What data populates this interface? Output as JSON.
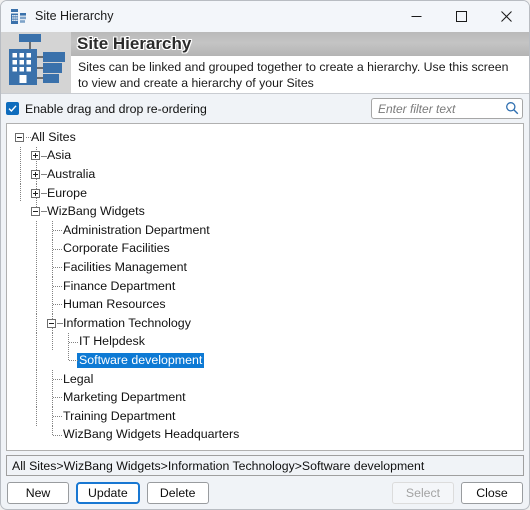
{
  "window": {
    "title": "Site Hierarchy",
    "icon": "site-hierarchy-icon",
    "controls": {
      "minimize": "minimize-icon",
      "maximize": "maximize-icon",
      "close": "close-icon"
    }
  },
  "header": {
    "icon": "building-hierarchy-icon",
    "title": "Site Hierarchy",
    "description": "Sites can be linked and grouped together to create a hierarchy.  Use this screen to view and create a hierarchy of your Sites"
  },
  "options": {
    "dragdrop_label": "Enable drag and drop re-ordering",
    "dragdrop_checked": true,
    "filter_value": "",
    "filter_placeholder": "Enter filter text",
    "filter_icon": "search-icon"
  },
  "tree": {
    "nodes": [
      {
        "label": "All Sites",
        "depth": 0,
        "expander": "minus",
        "selected": false
      },
      {
        "label": "Asia",
        "depth": 1,
        "expander": "plus",
        "selected": false
      },
      {
        "label": "Australia",
        "depth": 1,
        "expander": "plus",
        "selected": false
      },
      {
        "label": "Europe",
        "depth": 1,
        "expander": "plus",
        "selected": false
      },
      {
        "label": "WizBang Widgets",
        "depth": 1,
        "expander": "minus",
        "selected": false
      },
      {
        "label": "Administration Department",
        "depth": 2,
        "expander": "none",
        "selected": false
      },
      {
        "label": "Corporate Facilities",
        "depth": 2,
        "expander": "none",
        "selected": false
      },
      {
        "label": "Facilities Management",
        "depth": 2,
        "expander": "none",
        "selected": false
      },
      {
        "label": "Finance Department",
        "depth": 2,
        "expander": "none",
        "selected": false
      },
      {
        "label": "Human Resources",
        "depth": 2,
        "expander": "none",
        "selected": false
      },
      {
        "label": "Information Technology",
        "depth": 2,
        "expander": "minus",
        "selected": false
      },
      {
        "label": "IT Helpdesk",
        "depth": 3,
        "expander": "none",
        "selected": false
      },
      {
        "label": "Software development",
        "depth": 3,
        "expander": "none",
        "selected": true
      },
      {
        "label": "Legal",
        "depth": 2,
        "expander": "none",
        "selected": false
      },
      {
        "label": "Marketing Department",
        "depth": 2,
        "expander": "none",
        "selected": false
      },
      {
        "label": "Training Department",
        "depth": 2,
        "expander": "none",
        "selected": false
      },
      {
        "label": "WizBang Widgets Headquarters",
        "depth": 2,
        "expander": "none",
        "selected": false
      }
    ]
  },
  "path": {
    "text": "All Sites>WizBang Widgets>Information Technology>Software development"
  },
  "buttons": {
    "new": "New",
    "update": "Update",
    "delete": "Delete",
    "select": "Select",
    "close": "Close"
  },
  "colors": {
    "selection_blue": "#0e7ad4",
    "accent_blue": "#1877d2",
    "icon_blue": "#3a71ab",
    "header_band": "#bcbcbc"
  }
}
